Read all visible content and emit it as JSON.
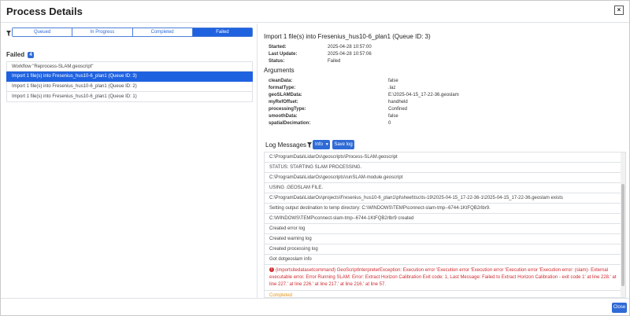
{
  "window": {
    "title": "Process Details",
    "close_glyph": "×"
  },
  "filters": {
    "tabs": [
      {
        "label": "Queued",
        "active": false
      },
      {
        "label": "In Progress",
        "active": false
      },
      {
        "label": "Completed",
        "active": false
      },
      {
        "label": "Failed",
        "active": true
      }
    ]
  },
  "list": {
    "heading": "Failed",
    "count": "4",
    "items": [
      {
        "label": "Workflow \"Reprocess-SLAM.geoscript\"",
        "active": false
      },
      {
        "label": "Import 1 file(s) into Fresenius_hus10-6_plan1 (Queue ID: 3)",
        "active": true
      },
      {
        "label": "Import 1 file(s) into Fresenius_hus10-6_plan1 (Queue ID: 2)",
        "active": false
      },
      {
        "label": "Import 1 file(s) into Fresenius_hus10-6_plan1 (Queue ID: 1)",
        "active": false
      }
    ]
  },
  "detail": {
    "title": "Import 1 file(s) into Fresenius_hus10-6_plan1 (Queue ID: 3)",
    "meta": [
      {
        "key": "Started:",
        "value": "2025-04-28 10:57:00"
      },
      {
        "key": "Last Update:",
        "value": "2025-04-28 10:57:06"
      },
      {
        "key": "Status:",
        "value": "Failed"
      }
    ],
    "arguments_heading": "Arguments",
    "arguments": [
      {
        "key": "cleanData:",
        "value": "false"
      },
      {
        "key": "formatType:",
        "value": ".laz"
      },
      {
        "key": "geoSLAMData:",
        "value": "E:\\2025-04-15_17-22-36.geoslam"
      },
      {
        "key": "myRefOffset:",
        "value": "handheld"
      },
      {
        "key": "processingType:",
        "value": "Confined"
      },
      {
        "key": "smoothData:",
        "value": "false"
      },
      {
        "key": "spatialDecimation:",
        "value": "0"
      }
    ]
  },
  "log": {
    "title": "Log Messages",
    "info_label": "Info",
    "save_label": "Save log",
    "messages": [
      {
        "text": "C:\\ProgramData\\LidarOs\\geoscripts\\Process-SLAM.geoscript",
        "kind": "normal"
      },
      {
        "text": "STATUS: STARTING SLAM PROCESSING.",
        "kind": "normal"
      },
      {
        "text": "C:\\ProgramData\\LidarOs\\geoscripts\\runSLAM-module.geoscript",
        "kind": "normal"
      },
      {
        "text": "USING .GEOSLAM FILE.",
        "kind": "normal"
      },
      {
        "text": "C:\\ProgramData\\LidarOs\\projects\\Fresenius_hus10-6_plan1\\pl\\sheet\\tsc\\ts-19\\2025-04-15_17-22-36-1\\2025-04-15_17-22-36.geoslam exists",
        "kind": "normal"
      },
      {
        "text": "Setting output destination to temp directory: C:\\WINDOWS\\TEMP\\connect-slam-tmp--6744-1KtFQB2rlbr9.",
        "kind": "normal"
      },
      {
        "text": "C:\\WINDOWS\\TEMP\\connect-slam-tmp--6744-1KtFQB2rlbr9 created",
        "kind": "normal"
      },
      {
        "text": "Created error log",
        "kind": "normal"
      },
      {
        "text": "Created warning log",
        "kind": "normal"
      },
      {
        "text": "Created processing log",
        "kind": "normal"
      },
      {
        "text": "Got dotgeoslam info",
        "kind": "normal"
      },
      {
        "text": "(importsitedatasetcommand) GeoScriptInterpreterException: Execution error 'Execution error 'Execution error 'Execution error 'Execution error: (slam)- External executable error. Error Running SLAM: Error: Extract Horizon Calibration Exit code: 1, Last Message: Failed to Extract Horizon Calibration - exit code 1' at line 228.' at line 227.' at line 226.' at line 217.' at line 216.' at line 57.",
        "kind": "error"
      },
      {
        "text": "Completed",
        "kind": "completed"
      }
    ]
  },
  "footer": {
    "close_label": "Close"
  },
  "colors": {
    "accent": "#1f62e0",
    "error": "#d0292f",
    "warning": "#e0951b"
  }
}
